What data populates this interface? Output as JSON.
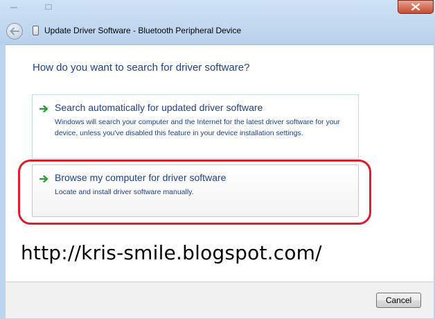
{
  "window": {
    "title": "Update Driver Software - Bluetooth Peripheral Device",
    "controls": {
      "minimize_icon": "minimize-icon",
      "maximize_icon": "maximize-icon",
      "close_icon": "close-icon"
    },
    "back_icon": "back-arrow-icon",
    "device_icon": "bluetooth-device-icon"
  },
  "content": {
    "heading": "How do you want to search for driver software?",
    "options": [
      {
        "title": "Search automatically for updated driver software",
        "description": "Windows will search your computer and the Internet for the latest driver software for your device, unless you've disabled this feature in your device installation settings.",
        "icon": "green-arrow-icon"
      },
      {
        "title": "Browse my computer for driver software",
        "description": "Locate and install driver software manually.",
        "icon": "green-arrow-icon"
      }
    ],
    "watermark": "http://kris-smile.blogspot.com/"
  },
  "footer": {
    "cancel_label": "Cancel"
  },
  "colors": {
    "link_blue": "#1d3f8c",
    "highlight_red": "#e01b2c",
    "close_red": "#c74b32"
  }
}
